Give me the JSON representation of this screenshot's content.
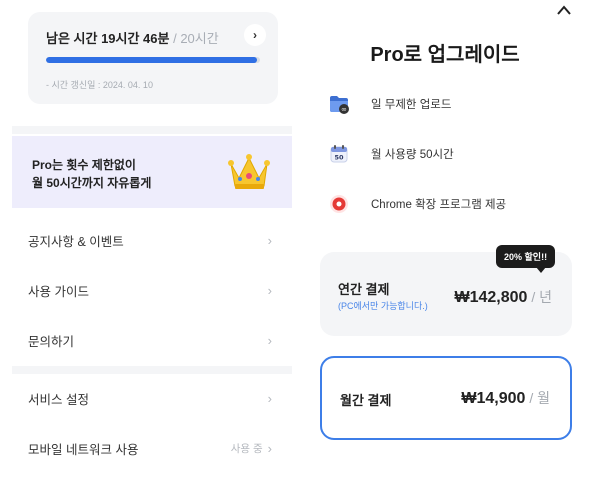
{
  "usage": {
    "remaining_label": "남은 시간 19시간 46분",
    "total_label": " / 20시간",
    "progress_fraction": 0.988,
    "updated_label": "- 시간 갱신일 : 2024. 04. 10"
  },
  "promo": {
    "line1": "Pro는 횟수 제한없이",
    "line2": "월 50시간까지 자유롭게"
  },
  "menu": {
    "items": [
      {
        "label": "공지사항 & 이벤트"
      },
      {
        "label": "사용 가이드"
      },
      {
        "label": "문의하기"
      },
      {
        "label": "서비스 설정"
      },
      {
        "label": "모바일 네트워크 사용",
        "status": "사용 중"
      }
    ]
  },
  "upgrade": {
    "title": "Pro로 업그레이드",
    "features": [
      {
        "label": "일 무제한 업로드",
        "icon": "folder-infinity-icon"
      },
      {
        "label": "월 사용량 50시간",
        "icon": "calendar-50-icon"
      },
      {
        "label": "Chrome 확장 프로그램 제공",
        "icon": "chrome-record-icon"
      }
    ],
    "annual": {
      "label": "연간 결제",
      "note": "(PC에서만 가능합니다.)",
      "price": "₩142,800",
      "unit": " / 년",
      "badge": "20% 할인!!"
    },
    "monthly": {
      "label": "월간 결제",
      "price": "₩14,900",
      "unit": " / 월",
      "selected": true
    }
  },
  "colors": {
    "accent": "#2f6fe4",
    "promo_bg": "#eeedfc",
    "card_bg": "#f4f5f7",
    "badge_bg": "#1c1c1c"
  }
}
